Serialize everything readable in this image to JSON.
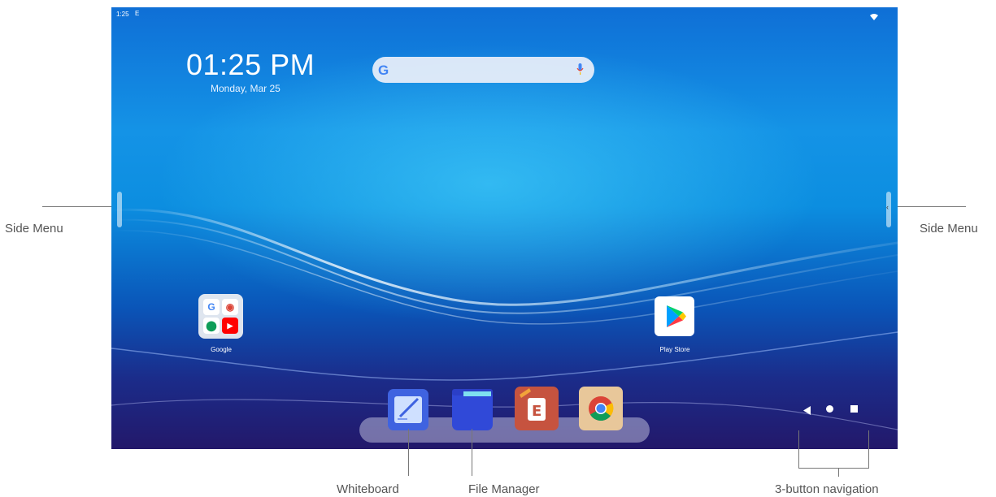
{
  "status_bar": {
    "time": "1:25",
    "signal_glyph": "E"
  },
  "clock": {
    "time": "01:25 PM",
    "date": "Monday, Mar 25"
  },
  "search": {
    "logo_text": "G"
  },
  "apps": {
    "google_folder": {
      "label": "Google",
      "mini_icons": [
        "G",
        "◉",
        "⬤",
        "▶"
      ]
    },
    "play_store": {
      "label": "Play Store"
    }
  },
  "dock": {
    "items": [
      {
        "name": "Whiteboard"
      },
      {
        "name": "File Manager"
      },
      {
        "name": "E"
      },
      {
        "name": "Chrome"
      }
    ]
  },
  "callouts": {
    "side_menu_left": "Side Menu",
    "side_menu_right": "Side Menu",
    "whiteboard": "Whiteboard",
    "file_manager": "File Manager",
    "nav": "3-button navigation"
  },
  "colors": {
    "wallpaper_top": "#0f6fd6",
    "wallpaper_bottom": "#23186a",
    "google_blue": "#4285f4"
  }
}
